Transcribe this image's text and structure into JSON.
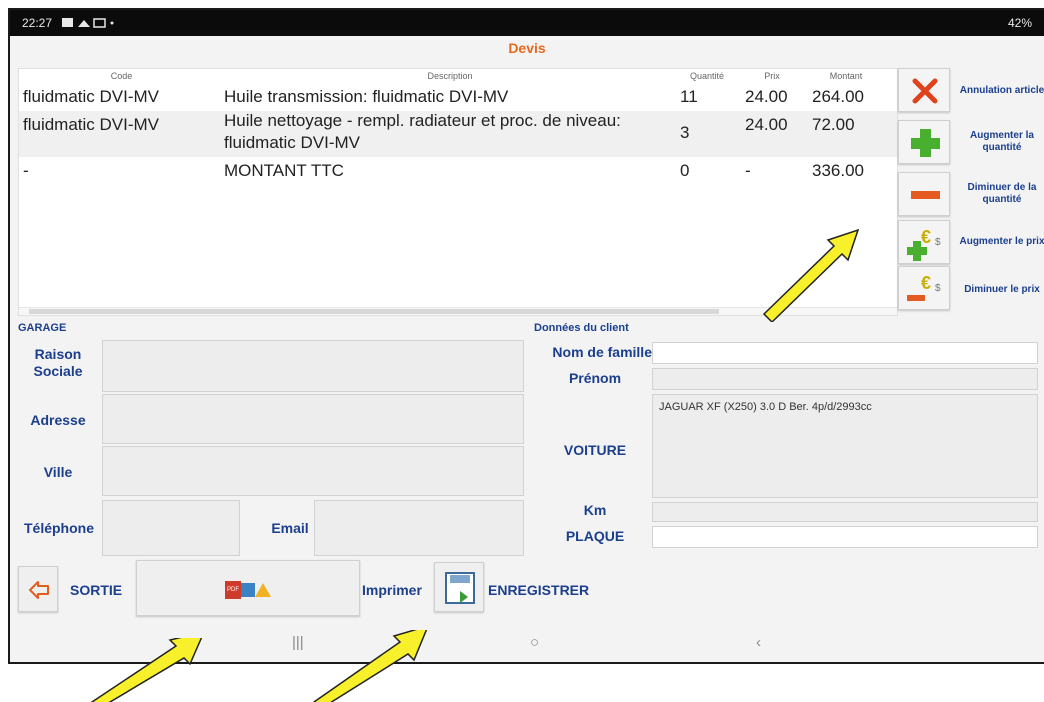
{
  "status_bar": {
    "time": "22:27",
    "status": "42%"
  },
  "screen_title": "Devis",
  "table": {
    "headers": {
      "code": "Code",
      "description": "Description",
      "quantity": "Quantité",
      "price": "Prix",
      "amount": "Montant"
    },
    "rows": [
      {
        "code": "fluidmatic DVI-MV",
        "description": "Huile transmission: fluidmatic DVI-MV",
        "quantity": "11",
        "price": "24.00",
        "amount": "264.00"
      },
      {
        "code": "fluidmatic DVI-MV",
        "description_line1": "Huile nettoyage - rempl. radiateur et proc. de niveau:",
        "description_line2": "fluidmatic DVI-MV",
        "quantity": "3",
        "price": "24.00",
        "amount": "72.00"
      },
      {
        "code": "-",
        "description": "MONTANT TTC",
        "quantity": "0",
        "price": "-",
        "amount": "336.00"
      }
    ]
  },
  "actions": {
    "cancel_line1": "Annulation article",
    "increase_qty_line1": "Augmenter la",
    "increase_qty_line2": "quantité",
    "decrease_qty_line1": "Diminuer de la",
    "decrease_qty_line2": "quantité",
    "increase_price": "Augmenter le prix",
    "decrease_price": "Diminuer le prix"
  },
  "garage": {
    "section_label": "GARAGE",
    "company_line1": "Raison",
    "company_line2": "Sociale",
    "address": "Adresse",
    "city": "Ville",
    "phone": "Téléphone",
    "email": "Email"
  },
  "client": {
    "section_label": "Données du client",
    "last_name": "Nom de famille",
    "first_name": "Prénom",
    "car": "VOITURE",
    "car_value": "JAGUAR XF (X250) 3.0 D Ber. 4p/d/2993cc",
    "km": "Km",
    "plate": "PLAQUE"
  },
  "bottom": {
    "exit": "SORTIE",
    "print": "Imprimer",
    "save": "ENREGISTRER"
  },
  "colors": {
    "title": "#e8691e",
    "label": "#1b3f8e",
    "highlight_arrow": "#f7f02a"
  }
}
